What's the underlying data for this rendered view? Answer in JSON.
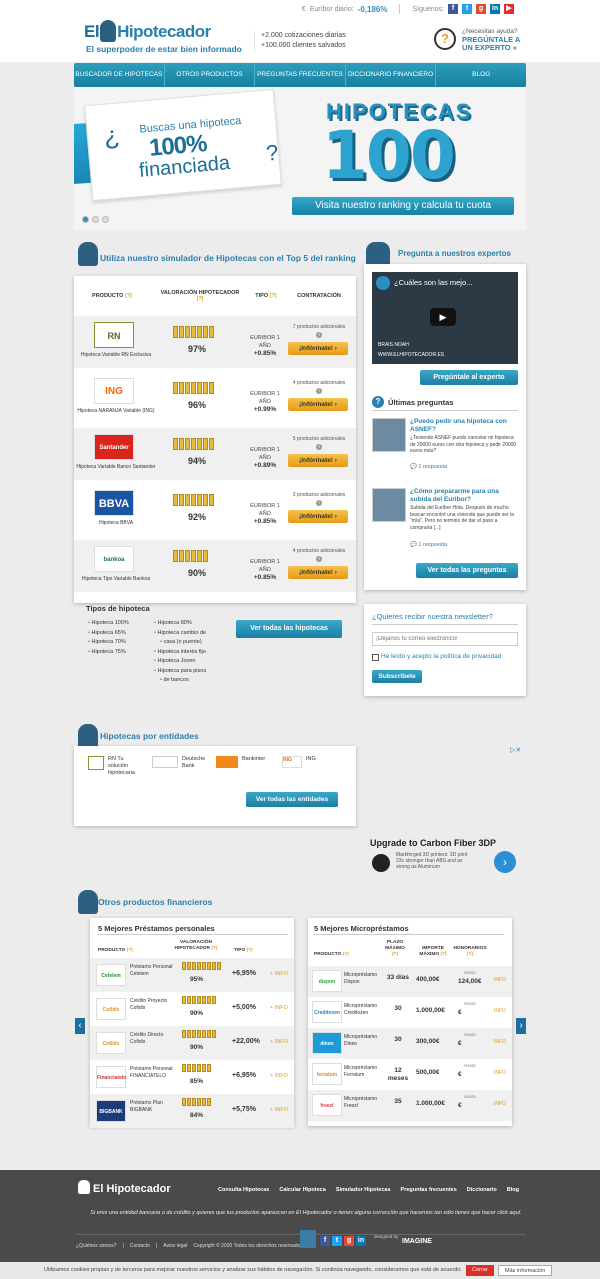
{
  "topbar": {
    "euribor_label": "Euríbor diario:",
    "euribor_value": "-0,186%",
    "follow_label": "Síguenos:"
  },
  "header": {
    "logo_el": "El",
    "logo_name": "Hipotecador",
    "tagline": "El superpoder de estar bien informado",
    "stat1": "+2.000 cotizaciones diarias",
    "stat2": "+100.000 clientes salvados",
    "help_q": "¿Necesitas ayuda?",
    "help_cta1": "PREGÚNTALE A",
    "help_cta2": "UN EXPERTO »"
  },
  "nav": [
    "BUSCADOR DE HIPOTECAS",
    "OTROS PRODUCTOS",
    "PREGUNTAS FRECUENTES",
    "DICCIONARIO FINANCIERO",
    "BLOG"
  ],
  "hero": {
    "line1": "Buscas una hipoteca",
    "line2": "100%",
    "line3": "financiada",
    "qopen": "¿",
    "qclose": "?",
    "title": "HIPOTECAS",
    "number": "100",
    "cta": "Visita nuestro ranking y calcula tu cuota"
  },
  "simulator": {
    "title": "Utiliza nuestro simulador de Hipotecas con el Top 5 del ranking",
    "headers": {
      "producto": "PRODUCTO",
      "valoracion": "VALORACIÓN HIPOTECADOR",
      "tipo": "TIPO",
      "contratacion": "CONTRATACIÓN",
      "help": "(?)"
    },
    "rows": [
      {
        "logo": "RN",
        "bank": "Hipoteca Variable RN Exclusiva",
        "pct": "97%",
        "type1": "EURIBOR 1",
        "type2": "AÑO",
        "diff": "+0.85%",
        "add": "7 productos adicionales",
        "btn": "¡Infórmate!"
      },
      {
        "logo": "ING",
        "bank": "Hipoteca NARANJA Variable (ING)",
        "pct": "96%",
        "type1": "EURIBOR 1",
        "type2": "AÑO",
        "diff": "+0.99%",
        "add": "4 productos adicionales",
        "btn": "¡Infórmate!"
      },
      {
        "logo": "Santander",
        "bank": "Hipoteca Variable Banco Santander",
        "pct": "94%",
        "type1": "EURIBOR 1",
        "type2": "AÑO",
        "diff": "+0.89%",
        "add": "5 productos adicionales",
        "btn": "¡Infórmate!"
      },
      {
        "logo": "BBVA",
        "bank": "Hipoteca BBVA",
        "pct": "92%",
        "type1": "EURIBOR 1",
        "type2": "AÑO",
        "diff": "+0.85%",
        "add": "3 productos adicionales",
        "btn": "¡Infórmate!"
      },
      {
        "logo": "bankoa",
        "bank": "Hipoteca Tipo Variable Bankoa",
        "pct": "90%",
        "type1": "EURIBOR 1",
        "type2": "AÑO",
        "diff": "+0.85%",
        "add": "4 productos adicionales",
        "btn": "¡Infórmate!"
      }
    ],
    "tipos_title": "Tipos de hipoteca",
    "tipos_col1": [
      "Hipoteca 100%",
      "Hipoteca 65%",
      "Hipoteca 70%",
      "Hipoteca 75%"
    ],
    "tipos_col2": [
      "Hipoteca 80%",
      "Hipoteca cambio de",
      "casa (o puente)",
      "Hipoteca interés fijo",
      "Hipoteca Joven",
      "Hipoteca para pisos",
      "de bancos"
    ],
    "ver_todas": "Ver todas las hipotecas"
  },
  "experts": {
    "title": "Pregunta a nuestros expertos",
    "video_title": "¿Cuáles son las mejo...",
    "video_name": "BRAIS NOAH",
    "video_url": "WWW.ELHIPOTECADOR.ES",
    "btn": "Pregúntale al experto",
    "ultimas": "Últimas preguntas",
    "q1_title": "¿Puedo pedir una hipoteca con ASNEF?",
    "q1_desc": "¿Teniendo ASNEF puedo cancelar mi hipoteca de 20000 euros con otra hipoteca y pedir 20000 euros más?",
    "q1_resp": "1 respuesta",
    "q2_title": "¿Cómo prepararme para una subida del Euribor?",
    "q2_desc": "Subida del Euribor Hola. Después de mucho buscar encontré una vivienda que puede ser la \"mía\". Pero no termino de dar el paso a comprarla [...]",
    "q2_resp": "1 respuesta",
    "ver_todas": "Ver todas las preguntas"
  },
  "newsletter": {
    "title": "¿Quieres recibir nuestra newsletter?",
    "placeholder": "¡Déjanos tu correo electrónico!",
    "privacy": "He leído y acepto la política de privacidad",
    "btn": "Subscribete"
  },
  "entities": {
    "title": "Hipotecas por entidades",
    "items": [
      {
        "name": "RN Tu solución hipotecaria"
      },
      {
        "name": "Deutsche Bank"
      },
      {
        "name": "Bankinter"
      },
      {
        "name": "ING"
      }
    ],
    "btn": "Ver todas las entidades"
  },
  "ad": {
    "title": "Upgrade to Carbon Fiber 3DP",
    "desc": "Markforged 3D printers: 3D print 23x stronger than ABS and as strong as Aluminum"
  },
  "otros": {
    "title": "Otros productos financieros",
    "prestamos": {
      "title": "5 Mejores Préstamos personales",
      "h_producto": "PRODUCTO",
      "h_val": "VALORACIÓN HIPOTECADOR",
      "h_tipo": "TIPO",
      "help": "(?)",
      "rows": [
        {
          "logo": "Cetelem",
          "name": "Préstamo Personal Cetelem",
          "pct": "95%",
          "tipo": "+6,95%",
          "info": "+ INFO"
        },
        {
          "logo": "Cofidis",
          "name": "Crédito Proyecto Cofidis",
          "pct": "90%",
          "tipo": "+5,00%",
          "info": "+ INFO"
        },
        {
          "logo": "Cofidis",
          "name": "Crédito Directo Cofidis",
          "pct": "90%",
          "tipo": "+22,00%",
          "info": "+ INFO"
        },
        {
          "logo": "Financiatelo",
          "name": "Préstamo Personal FINANCIATELO",
          "pct": "85%",
          "tipo": "+6,95%",
          "info": "+ INFO"
        },
        {
          "logo": "BIGBANK",
          "name": "Préstamo Plan BIGBANK",
          "pct": "84%",
          "tipo": "+5,75%",
          "info": "+ INFO"
        }
      ]
    },
    "micro": {
      "title": "5 Mejores Micropréstamos",
      "h_producto": "PRODUCTO",
      "h_plazo": "PLAZO MÁXIMO",
      "h_importe": "IMPORTE MÁXIMO",
      "h_hon": "HONORARIOS",
      "help": "(?)",
      "rows": [
        {
          "logo": "dispon",
          "name": "Micropréstamo Dispon",
          "plazo": "33 días",
          "importe": "400,00€",
          "hon_label": "Hasta",
          "hon": "124,00€",
          "info": "INFO"
        },
        {
          "logo": "Creditozen",
          "name": "Micropréstamo Creditozen",
          "plazo": "30",
          "importe": "1.000,00€",
          "hon_label": "Hasta",
          "hon": "€",
          "info": "INFO"
        },
        {
          "logo": "dineo",
          "name": "Micropréstamo Dineo",
          "plazo": "30",
          "importe": "300,00€",
          "hon_label": "Hasta",
          "hon": "€",
          "info": "INFO"
        },
        {
          "logo": "ferratum",
          "name": "Micropréstamo Ferratum",
          "plazo": "12 meses",
          "importe": "500,00€",
          "hon_label": "Hasta",
          "hon": "€",
          "info": "INFO"
        },
        {
          "logo": "freezl",
          "name": "Micropréstamo Freezl",
          "plazo": "35",
          "importe": "1.000,00€",
          "hon_label": "Hasta",
          "hon": "€",
          "info": "INFO"
        }
      ]
    }
  },
  "footer": {
    "logo": "El Hipotecador",
    "links": [
      "Consulta Hipotecas",
      "Calcular Hipoteca",
      "Simulador Hipotecas",
      "Preguntas frecuentes",
      "Diccionario",
      "Blog"
    ],
    "notice": "Si eres una entidad bancaria o de crédito y quieres que tus productos aparezcan en El Hipotecador o tienes alguna corrección que hacernos tan sólo tienes que hacer click aquí.",
    "bottom_links": [
      "¿Quiénes somos?",
      "Contacto",
      "Aviso legal"
    ],
    "copyright": "Copyright © 2020 Todos los derechos reservados",
    "designed": "designed by",
    "imagine": "IMAGINE"
  },
  "cookie": {
    "text": "Utilizamos cookies propias y de terceros para mejorar nuestros servicios y analizar sus hábitos de navegación. Si continúa navegando, consideramos que está de acuerdo.",
    "cerrar": "Cerrar",
    "mas": "Más información"
  }
}
